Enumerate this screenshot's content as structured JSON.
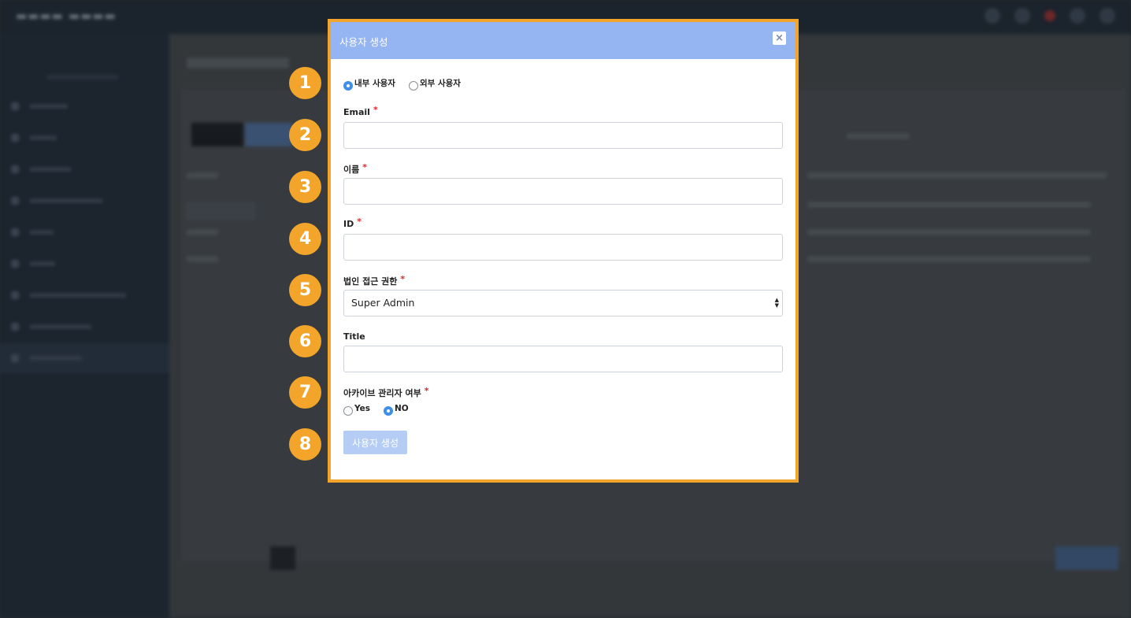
{
  "modal": {
    "title": "사용자 생성",
    "close_label": "×",
    "user_type": {
      "options": [
        {
          "label": "내부 사용자",
          "selected": true
        },
        {
          "label": "외부 사용자",
          "selected": false
        }
      ]
    },
    "email": {
      "label": "Email",
      "required": "*",
      "value": ""
    },
    "name": {
      "label": "이름",
      "required": "*",
      "value": ""
    },
    "id": {
      "label": "ID",
      "required": "*",
      "value": ""
    },
    "access": {
      "label": "법인 접근 권한",
      "required": "*",
      "value": "Super Admin"
    },
    "title_field": {
      "label": "Title",
      "value": ""
    },
    "archive_admin": {
      "label": "아카이브 관리자 여부",
      "required": "*",
      "options": [
        {
          "label": "Yes",
          "selected": false
        },
        {
          "label": "NO",
          "selected": true
        }
      ]
    },
    "submit_label": "사용자 생성"
  },
  "annotations": [
    "1",
    "2",
    "3",
    "4",
    "5",
    "6",
    "7",
    "8"
  ],
  "colors": {
    "highlight": "#f2a52a",
    "header": "#94b4f2",
    "radio_selected": "#3d8fe8",
    "submit_disabled": "#b5cdf5",
    "required": "#e02828"
  }
}
